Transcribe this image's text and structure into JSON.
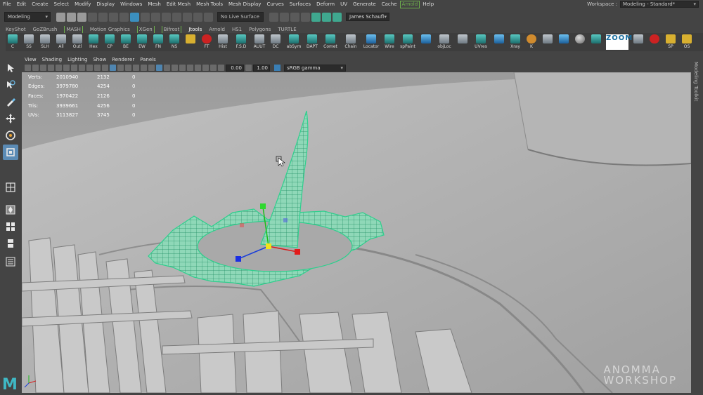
{
  "menubar": {
    "items": [
      "File",
      "Edit",
      "Create",
      "Select",
      "Modify",
      "Display",
      "Windows",
      "Mesh",
      "Edit Mesh",
      "Mesh Tools",
      "Mesh Display",
      "Curves",
      "Surfaces",
      "Deform",
      "UV",
      "Generate",
      "Cache",
      "Arnold",
      "Help"
    ],
    "workspace_label": "Workspace :",
    "workspace_value": "Modeling - Standard*"
  },
  "statusline": {
    "mode": "Modeling",
    "live_surface": "No Live Surface",
    "user": "James Schaufl"
  },
  "shelf_tabs": [
    "KeyShot",
    "GoZBrush",
    "MASH",
    "Motion Graphics",
    "XGen",
    "Bifrost",
    "Jtools",
    "Arnold",
    "HS1",
    "Polygons",
    "TURTLE"
  ],
  "shelf_tabs_boxed": [
    "MASH",
    "XGen",
    "Bifrost"
  ],
  "shelf_active_tab": "Jtools",
  "shelf_buttons": [
    {
      "label": "C",
      "icon": "teal"
    },
    {
      "label": "SS",
      "icon": "plain"
    },
    {
      "label": "SLH",
      "icon": "plain"
    },
    {
      "label": "All",
      "icon": "plain"
    },
    {
      "label": "Outl",
      "icon": "plain"
    },
    {
      "label": "Hex",
      "icon": "teal"
    },
    {
      "label": "CP",
      "icon": "teal"
    },
    {
      "label": "BE",
      "icon": "teal"
    },
    {
      "label": "EW",
      "icon": "teal"
    },
    {
      "label": "FN",
      "icon": "teal"
    },
    {
      "label": "NS",
      "icon": "teal"
    },
    {
      "label": "",
      "icon": "yellow"
    },
    {
      "label": "FT",
      "icon": "red"
    },
    {
      "label": "Hist",
      "icon": "plain"
    },
    {
      "label": "F.S.D",
      "icon": "teal"
    },
    {
      "label": "AUUT",
      "icon": "plain"
    },
    {
      "label": "DC",
      "icon": "plain"
    },
    {
      "label": "abSym",
      "icon": "teal"
    },
    {
      "label": "DAPT",
      "icon": "teal"
    },
    {
      "label": "Comet",
      "icon": "teal"
    },
    {
      "label": "Chain",
      "icon": "plain"
    },
    {
      "label": "Locator",
      "icon": "blue"
    },
    {
      "label": "Wire",
      "icon": "teal"
    },
    {
      "label": "spPaint",
      "icon": "teal"
    },
    {
      "label": "",
      "icon": "blue"
    },
    {
      "label": "objLoc",
      "icon": "plain"
    },
    {
      "label": "",
      "icon": "plain"
    },
    {
      "label": "UVres",
      "icon": "teal"
    },
    {
      "label": "",
      "icon": "blue"
    },
    {
      "label": "Xray",
      "icon": "teal"
    },
    {
      "label": "K",
      "icon": "orange"
    },
    {
      "label": "",
      "icon": "plain"
    },
    {
      "label": "",
      "icon": "blue"
    },
    {
      "label": "",
      "icon": "gray"
    },
    {
      "label": "",
      "icon": "teal"
    },
    {
      "label": "ZOOM",
      "icon": "zoom"
    },
    {
      "label": "",
      "icon": "plain"
    },
    {
      "label": "",
      "icon": "red"
    },
    {
      "label": "SP",
      "icon": "yellow"
    },
    {
      "label": "OS",
      "icon": "yellow"
    }
  ],
  "panel_menu": [
    "View",
    "Shading",
    "Lighting",
    "Show",
    "Renderer",
    "Panels"
  ],
  "panel_bar": {
    "field1": "0.00",
    "field2": "1.00",
    "color_space": "sRGB gamma"
  },
  "hud": [
    {
      "label": "Verts:",
      "total": "2010940",
      "selected": "2132",
      "components": "0"
    },
    {
      "label": "Edges:",
      "total": "3979780",
      "selected": "4254",
      "components": "0"
    },
    {
      "label": "Faces:",
      "total": "1970422",
      "selected": "2126",
      "components": "0"
    },
    {
      "label": "Tris:",
      "total": "3939661",
      "selected": "4256",
      "components": "0"
    },
    {
      "label": "UVs:",
      "total": "3113827",
      "selected": "3745",
      "components": "0"
    }
  ],
  "toolkit_tab": "Modeling Toolkit",
  "watermark": {
    "line1": "ANOMMA",
    "line2": "WORKSHOP"
  },
  "logo_text": "M",
  "colors": {
    "ui_bg": "#444444",
    "viewport_bg": "#a5a5a5",
    "wireframe": "#4de0a8",
    "accent_blue": "#5b8bb5",
    "arnold_green": "#6db04b"
  }
}
